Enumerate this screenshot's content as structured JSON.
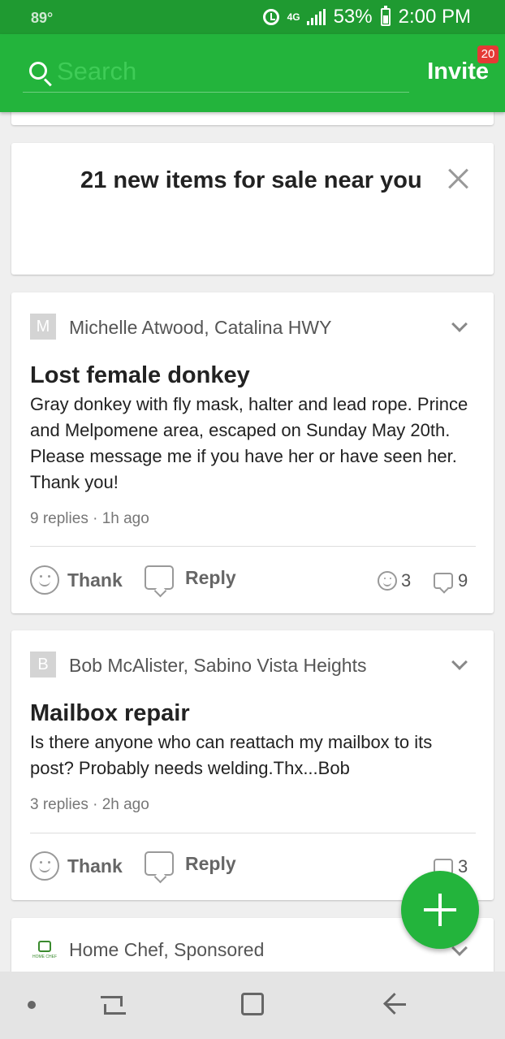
{
  "status_bar": {
    "temperature": "89°",
    "network": "4G",
    "battery_percent": "53%",
    "time": "2:00 PM"
  },
  "header": {
    "search_placeholder": "Search",
    "invite_label": "Invite",
    "notification_count": "20"
  },
  "sale_banner": {
    "title": "21 new items for sale near you"
  },
  "posts": [
    {
      "avatar_letter": "M",
      "author": "Michelle Atwood, Catalina HWY",
      "title": "Lost female donkey",
      "body": "Gray donkey with fly mask, halter and lead rope. Prince and Melpomene area, escaped on Sunday May 20th. Please message me if you have her or have seen her. Thank you!",
      "meta": "9 replies · 1h ago",
      "thank_label": "Thank",
      "reply_label": "Reply",
      "thanks_count": "3",
      "replies_count": "9"
    },
    {
      "avatar_letter": "B",
      "author": "Bob McAlister, Sabino Vista Heights",
      "title": "Mailbox repair",
      "body": "Is there anyone who can reattach my mailbox to its post? Probably needs welding.Thx...Bob",
      "meta": "3 replies · 2h ago",
      "thank_label": "Thank",
      "reply_label": "Reply",
      "replies_count": "3"
    },
    {
      "logo_text": "HOME CHEF",
      "author": "Home Chef, Sponsored"
    }
  ],
  "colors": {
    "status_bar": "#1f9a31",
    "header": "#23b43c",
    "fab": "#23b43c",
    "badge": "#e53935"
  },
  "icons": [
    "search-icon",
    "close-icon",
    "chevron-down-icon",
    "smile-icon",
    "speech-bubble-icon",
    "plus-icon",
    "back-icon",
    "home-icon",
    "recent-apps-icon"
  ]
}
